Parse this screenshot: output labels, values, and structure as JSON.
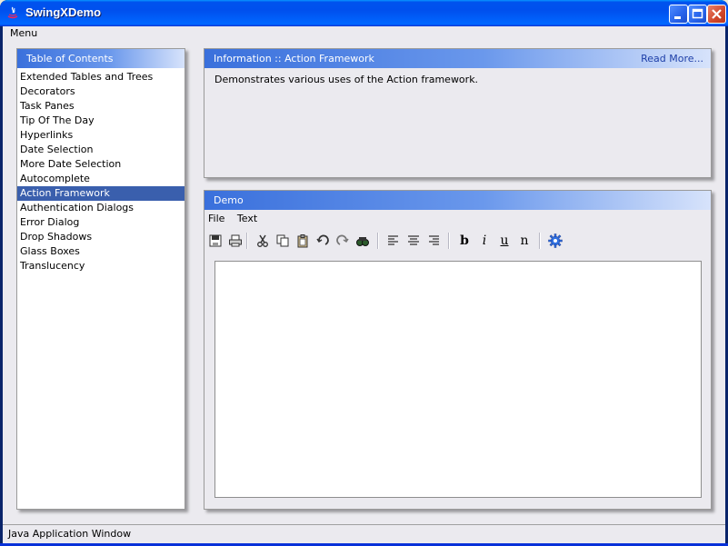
{
  "window": {
    "title": "SwingXDemo"
  },
  "menubar": {
    "menu_label": "Menu"
  },
  "toc": {
    "title": "Table of Contents",
    "items": [
      "Extended Tables and Trees",
      "Decorators",
      "Task Panes",
      "Tip Of The Day",
      "Hyperlinks",
      "Date Selection",
      "More Date Selection",
      "Autocomplete",
      "Action Framework",
      "Authentication Dialogs",
      "Error Dialog",
      "Drop Shadows",
      "Glass Boxes",
      "Translucency"
    ],
    "selected_index": 8
  },
  "info": {
    "title": "Information :: Action Framework",
    "read_more": "Read More...",
    "description": "Demonstrates various uses of the Action framework."
  },
  "demo": {
    "title": "Demo",
    "menus": [
      "File",
      "Text"
    ],
    "toolbar": {
      "bold_label": "b",
      "italic_label": "i",
      "underline_label": "u",
      "normal_label": "n",
      "icons": [
        "save-icon",
        "print-icon",
        "cut-icon",
        "copy-icon",
        "paste-icon",
        "undo-icon",
        "redo-icon",
        "find-icon",
        "align-left-icon",
        "align-center-icon",
        "align-right-icon",
        "settings-gear-icon"
      ]
    },
    "editor_text": ""
  },
  "status": {
    "text": "Java Application Window"
  },
  "colors": {
    "titlebar": "#0054e3",
    "panel_header_start": "#3a70dc",
    "selection": "#3a5fad",
    "read_more": "#1e3fa8"
  }
}
